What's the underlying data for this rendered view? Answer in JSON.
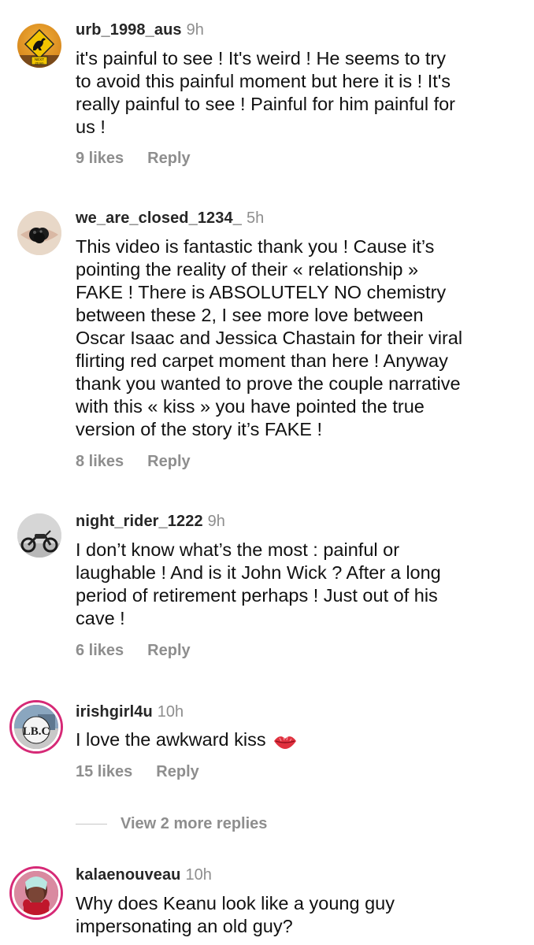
{
  "comments": [
    {
      "username": "urb_1998_aus",
      "time": "9h",
      "lines": [
        "it's painful to see ! It's weird ! He seems to try",
        "to avoid this painful moment but here it is ! It's",
        "really painful to see ! Painful for him painful for",
        "us !"
      ],
      "likes": "9 likes",
      "reply": "Reply",
      "avatar_sign": "NEXT\n20 km"
    },
    {
      "username": "we_are_closed_1234_",
      "time": "5h",
      "lines": [
        "This video is fantastic thank you ! Cause it’s",
        "pointing the reality of their « relationship »",
        "FAKE ! There is ABSOLUTELY NO chemistry",
        "between these 2, I see more love between",
        "Oscar Isaac and Jessica Chastain for their viral",
        "flirting red carpet moment than here ! Anyway",
        "thank you wanted to prove the couple narrative",
        "with this « kiss » you have pointed the true",
        "version of  the story it’s FAKE !"
      ],
      "likes": "8 likes",
      "reply": "Reply"
    },
    {
      "username": "night_rider_1222",
      "time": "9h",
      "lines": [
        "I don’t know what’s the most : painful or",
        "laughable ! And is it John Wick ? After a long",
        "period of retirement perhaps ! Just out of his",
        "cave !"
      ],
      "likes": "6 likes",
      "reply": "Reply"
    },
    {
      "username": "irishgirl4u",
      "time": "10h",
      "lines": [
        "I love the awkward kiss"
      ],
      "likes": "15 likes",
      "reply": "Reply",
      "avatar_text": "LB.C",
      "view_more": "View 2 more replies"
    },
    {
      "username": "kalaenouveau",
      "time": "10h",
      "lines": [
        "Why does Keanu look like a young guy",
        "impersonating an old guy?"
      ]
    }
  ],
  "colors": {
    "username": "#262626",
    "secondary": "#8e8e8e",
    "story_ring": "#d62976"
  }
}
